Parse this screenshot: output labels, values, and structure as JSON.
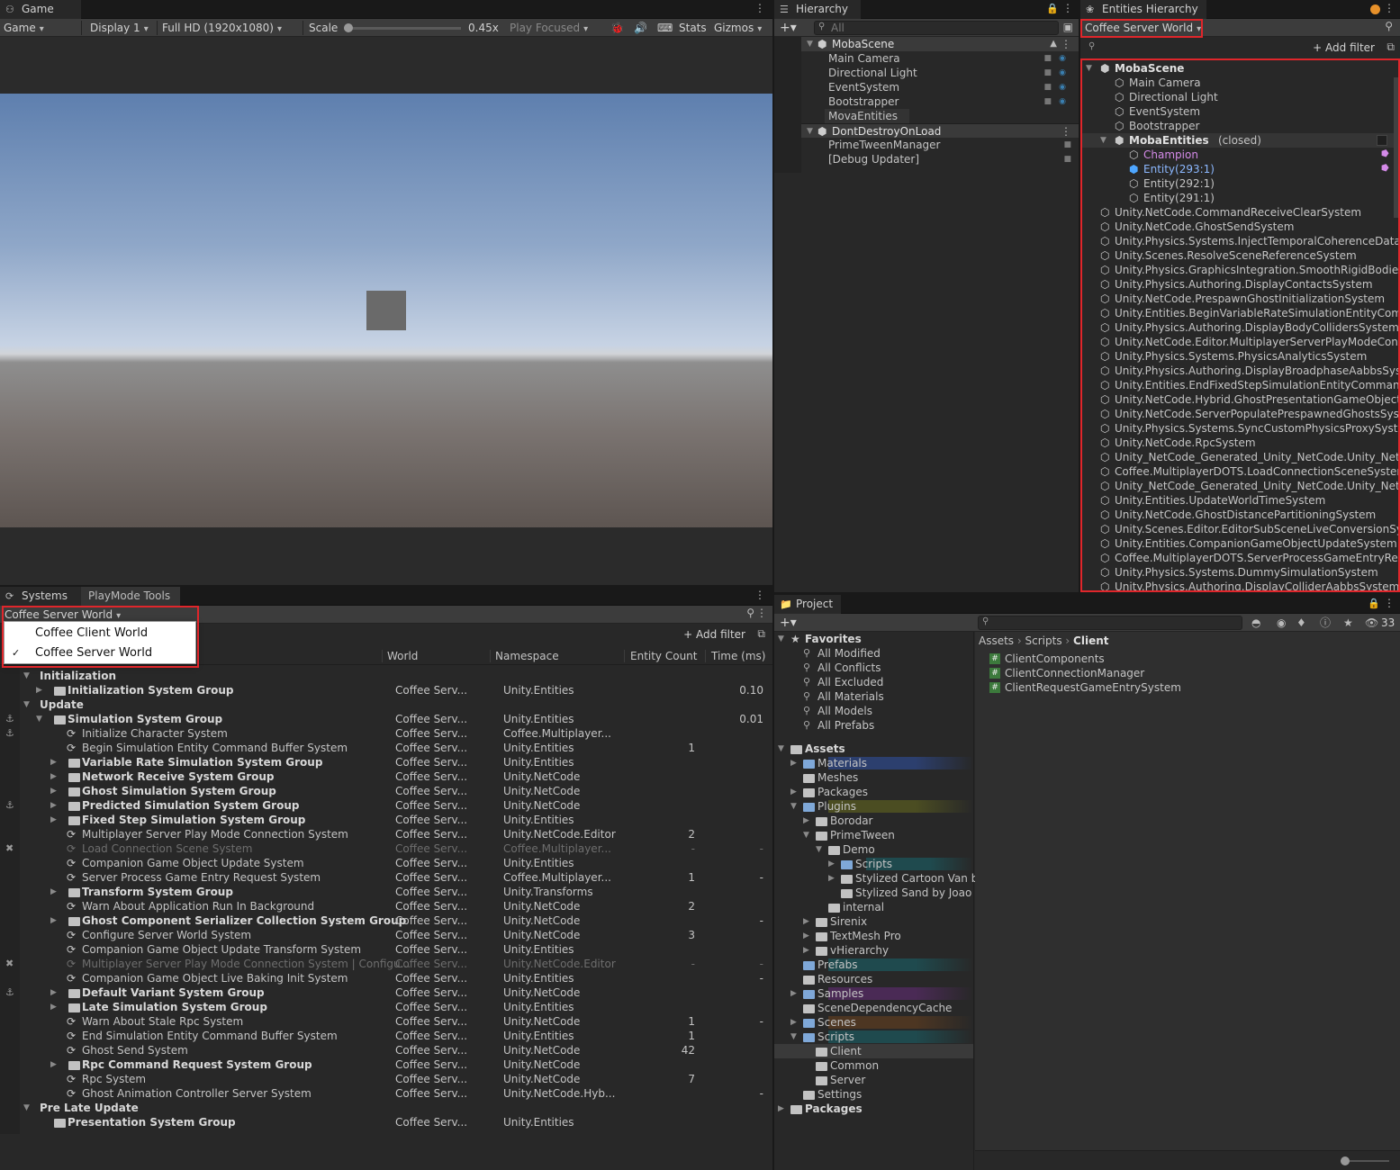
{
  "game": {
    "tab_label": "Game",
    "toolbar": {
      "view_mode": "Game",
      "display": "Display 1",
      "resolution": "Full HD (1920x1080)",
      "scale_label": "Scale",
      "scale_value": "0.45x",
      "scale_fraction": 0.02,
      "play_mode": "Play Focused",
      "stats": "Stats",
      "gizmos": "Gizmos"
    },
    "colors": {
      "sky_top": "#5e7fae",
      "sky_horizon": "#c7d3e4",
      "ground_top": "#8e8e8e",
      "ground_bottom": "#5d5551",
      "cube": "#6a6a6a",
      "letterbox": "#2b2b2b"
    }
  },
  "hierarchy": {
    "tab_label": "Hierarchy",
    "search_placeholder": "All",
    "items": [
      {
        "label": "MobaScene",
        "kind": "scene"
      },
      {
        "label": "Main Camera",
        "kind": "object"
      },
      {
        "label": "Directional Light",
        "kind": "object"
      },
      {
        "label": "EventSystem",
        "kind": "object"
      },
      {
        "label": "Bootstrapper",
        "kind": "object"
      },
      {
        "label": "MovaEntities",
        "kind": "object"
      },
      {
        "label": "DontDestroyOnLoad",
        "kind": "scene"
      },
      {
        "label": "PrimeTweenManager",
        "kind": "object"
      },
      {
        "label": "[Debug Updater]",
        "kind": "object"
      }
    ]
  },
  "entities": {
    "tab_label": "Entities Hierarchy",
    "world": "Coffee Server World",
    "add_filter": "+ Add filter",
    "tree": [
      {
        "label": "MobaScene",
        "kind": "scene"
      },
      {
        "label": "Main Camera",
        "kind": "go"
      },
      {
        "label": "Directional Light",
        "kind": "go"
      },
      {
        "label": "EventSystem",
        "kind": "go"
      },
      {
        "label": "Bootstrapper",
        "kind": "go"
      },
      {
        "label": "MobaEntities",
        "kind": "subscene",
        "note": "(closed)"
      },
      {
        "label": "Champion",
        "kind": "prefab"
      },
      {
        "label": "Entity(293:1)",
        "kind": "entity-selected"
      },
      {
        "label": "Entity(292:1)",
        "kind": "entity"
      },
      {
        "label": "Entity(291:1)",
        "kind": "entity"
      }
    ],
    "systems": [
      "Unity.NetCode.CommandReceiveClearSystem",
      "Unity.NetCode.GhostSendSystem",
      "Unity.Physics.Systems.InjectTemporalCoherenceData",
      "Unity.Scenes.ResolveSceneReferenceSystem",
      "Unity.Physics.GraphicsIntegration.SmoothRigidBodies",
      "Unity.Physics.Authoring.DisplayContactsSystem",
      "Unity.NetCode.PrespawnGhostInitializationSystem",
      "Unity.Entities.BeginVariableRateSimulationEntityComm",
      "Unity.Physics.Authoring.DisplayBodyCollidersSystem",
      "Unity.NetCode.Editor.MultiplayerServerPlayModeCon",
      "Unity.Physics.Systems.PhysicsAnalyticsSystem",
      "Unity.Physics.Authoring.DisplayBroadphaseAabbsSys",
      "Unity.Entities.EndFixedStepSimulationEntityCommanc",
      "Unity.NetCode.Hybrid.GhostPresentationGameObject",
      "Unity.NetCode.ServerPopulatePrespawnedGhostsSys",
      "Unity.Physics.Systems.SyncCustomPhysicsProxySyst",
      "Unity.NetCode.RpcSystem",
      "Unity_NetCode_Generated_Unity_NetCode.Unity_Neto",
      "Coffee.MultiplayerDOTS.LoadConnectionSceneSystem",
      "Unity_NetCode_Generated_Unity_NetCode.Unity_Neto",
      "Unity.Entities.UpdateWorldTimeSystem",
      "Unity.NetCode.GhostDistancePartitioningSystem",
      "Unity.Scenes.Editor.EditorSubSceneLiveConversionSy",
      "Unity.Entities.CompanionGameObjectUpdateSystem",
      "Coffee.MultiplayerDOTS.ServerProcessGameEntryRec",
      "Unity.Physics.Systems.DummySimulationSystem",
      "Unity.Physics.Authoring.DisplayColliderAabbsSystem"
    ]
  },
  "systems_panel": {
    "tabs": [
      "Systems",
      "PlayMode Tools"
    ],
    "world": "Coffee Server World",
    "add_filter": "+ Add filter",
    "world_options": [
      {
        "label": "Coffee Client World",
        "checked": false
      },
      {
        "label": "Coffee Server World",
        "checked": true
      }
    ],
    "columns": {
      "world": "World",
      "namespace": "Namespace",
      "entity_count": "Entity Count",
      "time": "Time (ms)"
    },
    "rows": [
      {
        "depth": 0,
        "name": "Initialization",
        "type": "phase",
        "world": "",
        "ns": "",
        "count": "",
        "time": ""
      },
      {
        "depth": 1,
        "name": "Initialization System Group",
        "type": "group",
        "fold": "right",
        "world": "Coffee Serv...",
        "ns": "Unity.Entities",
        "count": "",
        "time": "0.10"
      },
      {
        "depth": 0,
        "name": "Update",
        "type": "phase",
        "world": "",
        "ns": "",
        "count": "",
        "time": ""
      },
      {
        "depth": 1,
        "name": "Simulation System Group",
        "type": "group",
        "fold": "down",
        "world": "Coffee Serv...",
        "ns": "Unity.Entities",
        "count": "",
        "time": "0.01"
      },
      {
        "depth": 2,
        "name": "Initialize Character System",
        "type": "system",
        "world": "Coffee Serv...",
        "ns": "Coffee.Multiplayer...",
        "count": "",
        "time": ""
      },
      {
        "depth": 2,
        "name": "Begin Simulation Entity Command Buffer System",
        "type": "ecb",
        "world": "Coffee Serv...",
        "ns": "Unity.Entities",
        "count": "1",
        "time": ""
      },
      {
        "depth": 2,
        "name": "Variable Rate Simulation System Group",
        "type": "group",
        "fold": "right",
        "world": "Coffee Serv...",
        "ns": "Unity.Entities",
        "count": "",
        "time": ""
      },
      {
        "depth": 2,
        "name": "Network Receive System Group",
        "type": "group",
        "fold": "right",
        "world": "Coffee Serv...",
        "ns": "Unity.NetCode",
        "count": "",
        "time": ""
      },
      {
        "depth": 2,
        "name": "Ghost Simulation System Group",
        "type": "group",
        "fold": "right",
        "world": "Coffee Serv...",
        "ns": "Unity.NetCode",
        "count": "",
        "time": ""
      },
      {
        "depth": 2,
        "name": "Predicted Simulation System Group",
        "type": "group",
        "fold": "right",
        "world": "Coffee Serv...",
        "ns": "Unity.NetCode",
        "count": "",
        "time": ""
      },
      {
        "depth": 2,
        "name": "Fixed Step Simulation System Group",
        "type": "group",
        "fold": "right",
        "world": "Coffee Serv...",
        "ns": "Unity.Entities",
        "count": "",
        "time": ""
      },
      {
        "depth": 2,
        "name": "Multiplayer Server Play Mode Connection System",
        "type": "system",
        "world": "Coffee Serv...",
        "ns": "Unity.NetCode.Editor",
        "count": "2",
        "time": ""
      },
      {
        "depth": 2,
        "name": "Load Connection Scene System",
        "type": "system",
        "disabled": true,
        "world": "Coffee Serv...",
        "ns": "Coffee.Multiplayer...",
        "count": "-",
        "time": "-"
      },
      {
        "depth": 2,
        "name": "Companion Game Object Update System",
        "type": "system",
        "world": "Coffee Serv...",
        "ns": "Unity.Entities",
        "count": "",
        "time": ""
      },
      {
        "depth": 2,
        "name": "Server Process Game Entry Request System",
        "type": "system",
        "world": "Coffee Serv...",
        "ns": "Coffee.Multiplayer...",
        "count": "1",
        "time": "-"
      },
      {
        "depth": 2,
        "name": "Transform System Group",
        "type": "group",
        "fold": "right",
        "world": "Coffee Serv...",
        "ns": "Unity.Transforms",
        "count": "",
        "time": ""
      },
      {
        "depth": 2,
        "name": "Warn About Application Run In Background",
        "type": "system",
        "world": "Coffee Serv...",
        "ns": "Unity.NetCode",
        "count": "2",
        "time": ""
      },
      {
        "depth": 2,
        "name": "Ghost Component Serializer Collection System Group",
        "type": "group",
        "fold": "right",
        "world": "Coffee Serv...",
        "ns": "Unity.NetCode",
        "count": "",
        "time": "-"
      },
      {
        "depth": 2,
        "name": "Configure Server World System",
        "type": "system",
        "world": "Coffee Serv...",
        "ns": "Unity.NetCode",
        "count": "3",
        "time": ""
      },
      {
        "depth": 2,
        "name": "Companion Game Object Update Transform System",
        "type": "system",
        "world": "Coffee Serv...",
        "ns": "Unity.Entities",
        "count": "",
        "time": ""
      },
      {
        "depth": 2,
        "name": "Multiplayer Server Play Mode Connection System | Configu...",
        "type": "system",
        "disabled": true,
        "world": "Coffee Serv...",
        "ns": "Unity.NetCode.Editor",
        "count": "-",
        "time": "-"
      },
      {
        "depth": 2,
        "name": "Companion Game Object Live Baking Init System",
        "type": "system",
        "world": "Coffee Serv...",
        "ns": "Unity.Entities",
        "count": "",
        "time": "-"
      },
      {
        "depth": 2,
        "name": "Default Variant System Group",
        "type": "group",
        "fold": "right",
        "world": "Coffee Serv...",
        "ns": "Unity.NetCode",
        "count": "",
        "time": ""
      },
      {
        "depth": 2,
        "name": "Late Simulation System Group",
        "type": "group",
        "fold": "right",
        "world": "Coffee Serv...",
        "ns": "Unity.Entities",
        "count": "",
        "time": ""
      },
      {
        "depth": 2,
        "name": "Warn About Stale Rpc System",
        "type": "system",
        "world": "Coffee Serv...",
        "ns": "Unity.NetCode",
        "count": "1",
        "time": "-"
      },
      {
        "depth": 2,
        "name": "End Simulation Entity Command Buffer System",
        "type": "ecb",
        "world": "Coffee Serv...",
        "ns": "Unity.Entities",
        "count": "1",
        "time": ""
      },
      {
        "depth": 2,
        "name": "Ghost Send System",
        "type": "system",
        "world": "Coffee Serv...",
        "ns": "Unity.NetCode",
        "count": "42",
        "time": ""
      },
      {
        "depth": 2,
        "name": "Rpc Command Request System Group",
        "type": "group",
        "fold": "right",
        "world": "Coffee Serv...",
        "ns": "Unity.NetCode",
        "count": "",
        "time": ""
      },
      {
        "depth": 2,
        "name": "Rpc System",
        "type": "system",
        "world": "Coffee Serv...",
        "ns": "Unity.NetCode",
        "count": "7",
        "time": ""
      },
      {
        "depth": 2,
        "name": "Ghost Animation Controller Server System",
        "type": "system",
        "world": "Coffee Serv...",
        "ns": "Unity.NetCode.Hyb...",
        "count": "",
        "time": "-"
      },
      {
        "depth": 0,
        "name": "Pre Late Update",
        "type": "phase",
        "world": "",
        "ns": "",
        "count": "",
        "time": ""
      },
      {
        "depth": 1,
        "name": "Presentation System Group",
        "type": "group",
        "fold": "none",
        "world": "Coffee Serv...",
        "ns": "Unity.Entities",
        "count": "",
        "time": ""
      }
    ]
  },
  "project": {
    "tab_label": "Project",
    "hidden_count": "33",
    "breadcrumb": [
      "Assets",
      "Scripts",
      "Client"
    ],
    "favorites_label": "Favorites",
    "favorites": [
      "All Modified",
      "All Conflicts",
      "All Excluded",
      "All Materials",
      "All Models",
      "All Prefabs"
    ],
    "tree": [
      {
        "label": "Assets",
        "depth": 0,
        "fold": "down",
        "bold": true,
        "color": ""
      },
      {
        "label": "Materials",
        "depth": 1,
        "fold": "right",
        "color": "#2c3f6e"
      },
      {
        "label": "Meshes",
        "depth": 1,
        "fold": "none",
        "color": ""
      },
      {
        "label": "Packages",
        "depth": 1,
        "fold": "right",
        "color": ""
      },
      {
        "label": "Plugins",
        "depth": 1,
        "fold": "down",
        "color": "#4b4d22"
      },
      {
        "label": "Borodar",
        "depth": 2,
        "fold": "right",
        "color": ""
      },
      {
        "label": "PrimeTween",
        "depth": 2,
        "fold": "down",
        "color": ""
      },
      {
        "label": "Demo",
        "depth": 3,
        "fold": "down",
        "color": ""
      },
      {
        "label": "Scripts",
        "depth": 4,
        "fold": "right",
        "color": "#1f4a4e"
      },
      {
        "label": "Stylized Cartoon Van by",
        "depth": 4,
        "fold": "right",
        "color": ""
      },
      {
        "label": "Stylized Sand by Joao I",
        "depth": 4,
        "fold": "none",
        "color": ""
      },
      {
        "label": "internal",
        "depth": 3,
        "fold": "none",
        "color": ""
      },
      {
        "label": "Sirenix",
        "depth": 2,
        "fold": "right",
        "color": ""
      },
      {
        "label": "TextMesh Pro",
        "depth": 2,
        "fold": "right",
        "color": ""
      },
      {
        "label": "vHierarchy",
        "depth": 2,
        "fold": "right",
        "color": ""
      },
      {
        "label": "Prefabs",
        "depth": 1,
        "fold": "none",
        "color": "#1f4a4e"
      },
      {
        "label": "Resources",
        "depth": 1,
        "fold": "none",
        "color": ""
      },
      {
        "label": "Samples",
        "depth": 1,
        "fold": "right",
        "color": "#4a2a55"
      },
      {
        "label": "SceneDependencyCache",
        "depth": 1,
        "fold": "none",
        "color": ""
      },
      {
        "label": "Scenes",
        "depth": 1,
        "fold": "right",
        "color": "#4d3622"
      },
      {
        "label": "Scripts",
        "depth": 1,
        "fold": "down",
        "color": "#1f4a4e"
      },
      {
        "label": "Client",
        "depth": 2,
        "fold": "none",
        "color": "",
        "selected": true
      },
      {
        "label": "Common",
        "depth": 2,
        "fold": "none",
        "color": ""
      },
      {
        "label": "Server",
        "depth": 2,
        "fold": "none",
        "color": ""
      },
      {
        "label": "Settings",
        "depth": 1,
        "fold": "none",
        "color": ""
      },
      {
        "label": "Packages",
        "depth": 0,
        "fold": "right",
        "bold": true,
        "color": ""
      }
    ],
    "files": [
      "ClientComponents",
      "ClientConnectionManager",
      "ClientRequestGameEntrySystem"
    ]
  }
}
